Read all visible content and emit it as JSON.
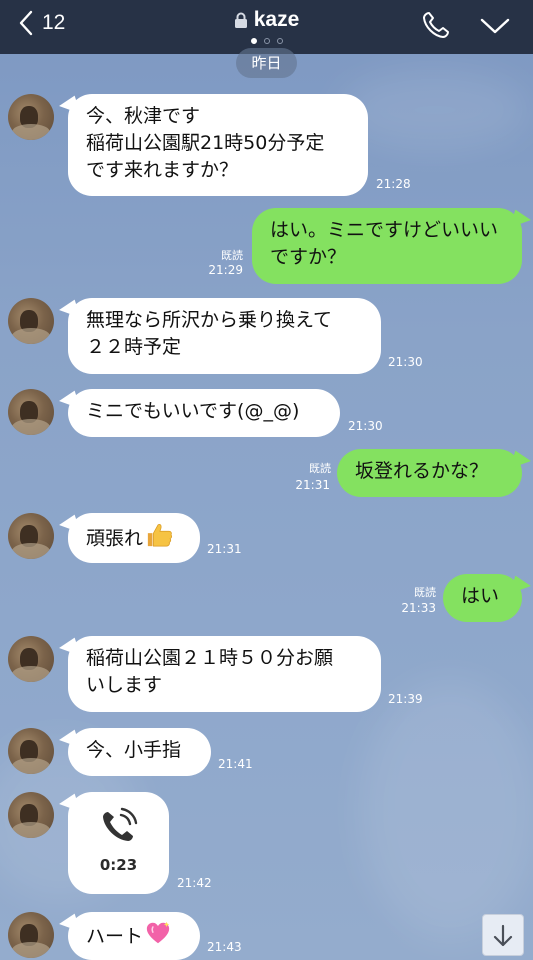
{
  "header": {
    "back_count": "12",
    "title": "kaze",
    "page_dots": 3,
    "active_dot": 0,
    "bg_color": "#273246"
  },
  "date_label": "昨日",
  "messages": [
    {
      "side": "left",
      "lines": [
        "今、秋津です",
        "稲荷山公園駅21時50分予定",
        "です来れますか？"
      ],
      "time": "21:28"
    },
    {
      "side": "right",
      "lines": [
        "はい。ミニですけどいいい",
        "ですか？"
      ],
      "read": "既読",
      "time": "21:29"
    },
    {
      "side": "left",
      "lines": [
        "無理なら所沢から乗り換えて",
        "２２時予定"
      ],
      "time": "21:30"
    },
    {
      "side": "left",
      "lines": [
        "ミニでもいいです(@_@)"
      ],
      "time": "21:30"
    },
    {
      "side": "right",
      "lines": [
        "坂登れるかな？"
      ],
      "read": "既読",
      "time": "21:31"
    },
    {
      "side": "left",
      "lines": [
        "頑張れ"
      ],
      "emoji": "thumbs-up",
      "time": "21:31"
    },
    {
      "side": "right",
      "lines": [
        "はい"
      ],
      "read": "既読",
      "time": "21:33"
    },
    {
      "side": "left",
      "lines": [
        "稲荷山公園２１時５０分お願",
        "いします"
      ],
      "time": "21:39"
    },
    {
      "side": "left",
      "lines": [
        "今、小手指"
      ],
      "time": "21:41"
    },
    {
      "side": "left",
      "type": "call",
      "duration": "0:23",
      "time": "21:42"
    },
    {
      "side": "left",
      "lines": [
        "ハート"
      ],
      "emoji": "sparkling-heart",
      "time": "21:43"
    }
  ],
  "colors": {
    "incoming_bubble": "#ffffff",
    "outgoing_bubble": "#84e160"
  },
  "icons": {
    "back": "chevron-left-icon",
    "lock": "lock-icon",
    "call": "phone-icon",
    "menu": "chevron-down-icon",
    "scroll": "arrow-down-icon"
  }
}
